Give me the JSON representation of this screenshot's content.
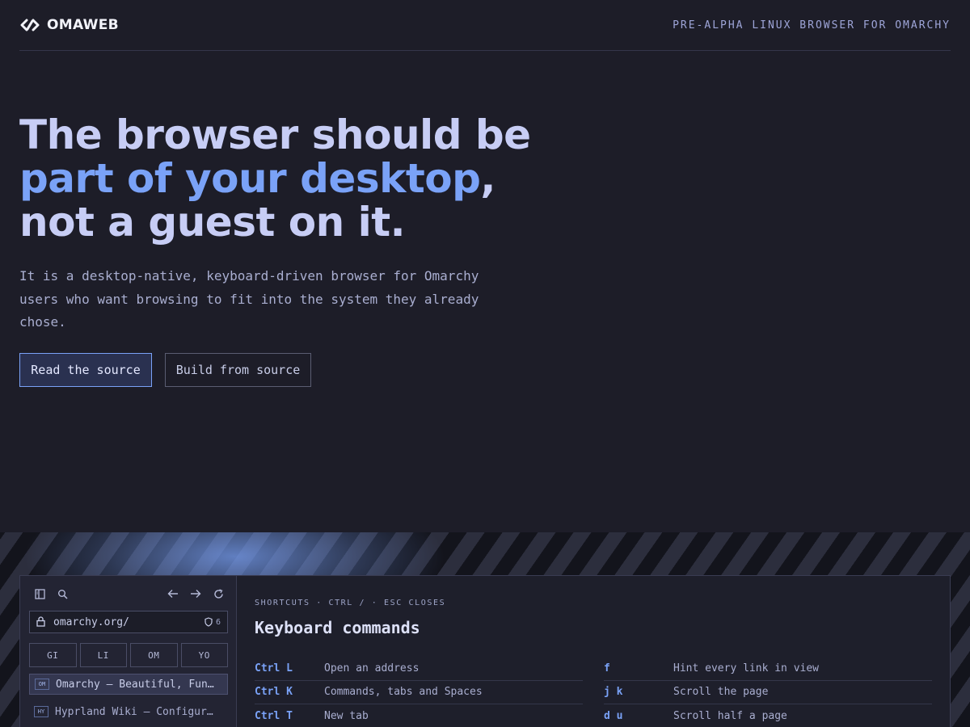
{
  "header": {
    "brand": "OMAWEB",
    "tagline": "PRE-ALPHA LINUX BROWSER FOR OMARCHY"
  },
  "hero": {
    "title_line1": "The browser should be",
    "title_accent": "part of your desktop",
    "title_comma": ",",
    "title_line3": "not a guest on it.",
    "description": "It is a desktop-native, keyboard-driven browser for Omarchy users who want browsing to fit into the system they already chose.",
    "primary_button": "Read the source",
    "secondary_button": "Build from source"
  },
  "browser": {
    "toolbar_icons": [
      "sidebar-toggle-icon",
      "search-icon",
      "back-arrow-icon",
      "forward-arrow-icon",
      "reload-icon"
    ],
    "address": "omarchy.org/",
    "blocked_count": "6",
    "spaces": [
      "GI",
      "LI",
      "OM",
      "YO"
    ],
    "tabs": [
      {
        "favicon": "OM",
        "title": "Omarchy — Beautiful, Fun…",
        "active": true
      },
      {
        "favicon": "HY",
        "title": "Hyprland Wiki — Configur…",
        "active": false
      }
    ]
  },
  "shortcuts": {
    "kicker": "SHORTCUTS · CTRL / · ESC CLOSES",
    "title": "Keyboard commands",
    "left": [
      {
        "key": "Ctrl L",
        "desc": "Open an address"
      },
      {
        "key": "Ctrl K",
        "desc": "Commands, tabs and Spaces"
      },
      {
        "key": "Ctrl T",
        "desc": "New tab"
      }
    ],
    "right": [
      {
        "key": "f",
        "desc": "Hint every link in view"
      },
      {
        "key": "j k",
        "desc": "Scroll the page"
      },
      {
        "key": "d u",
        "desc": "Scroll half a page"
      }
    ]
  },
  "colors": {
    "background": "#1d1d28",
    "accent": "#7aa2f7",
    "title": "#c7cdf5",
    "panel": "#1e1f2b"
  }
}
